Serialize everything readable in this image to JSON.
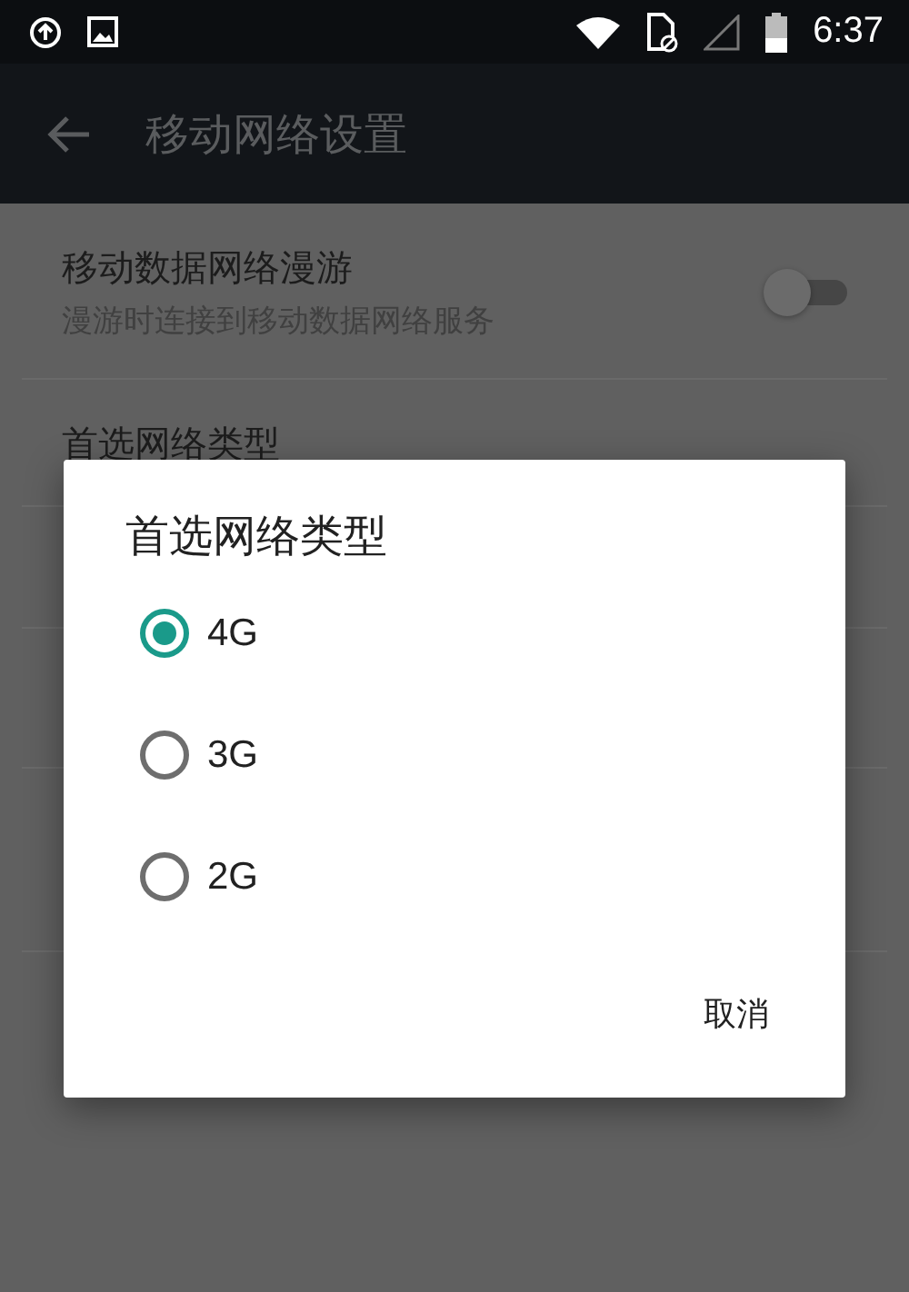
{
  "status_bar": {
    "time": "6:37"
  },
  "toolbar": {
    "title": "移动网络设置"
  },
  "settings": [
    {
      "kind": "switch",
      "title": "移动数据网络漫游",
      "summary": "漫游时连接到移动数据网络服务",
      "on": false
    },
    {
      "kind": "plain",
      "title": "首选网络类型"
    }
  ],
  "dialog": {
    "title": "首选网络类型",
    "options": [
      {
        "label": "4G",
        "selected": true
      },
      {
        "label": "3G",
        "selected": false
      },
      {
        "label": "2G",
        "selected": false
      }
    ],
    "buttons": [
      "取消"
    ]
  }
}
